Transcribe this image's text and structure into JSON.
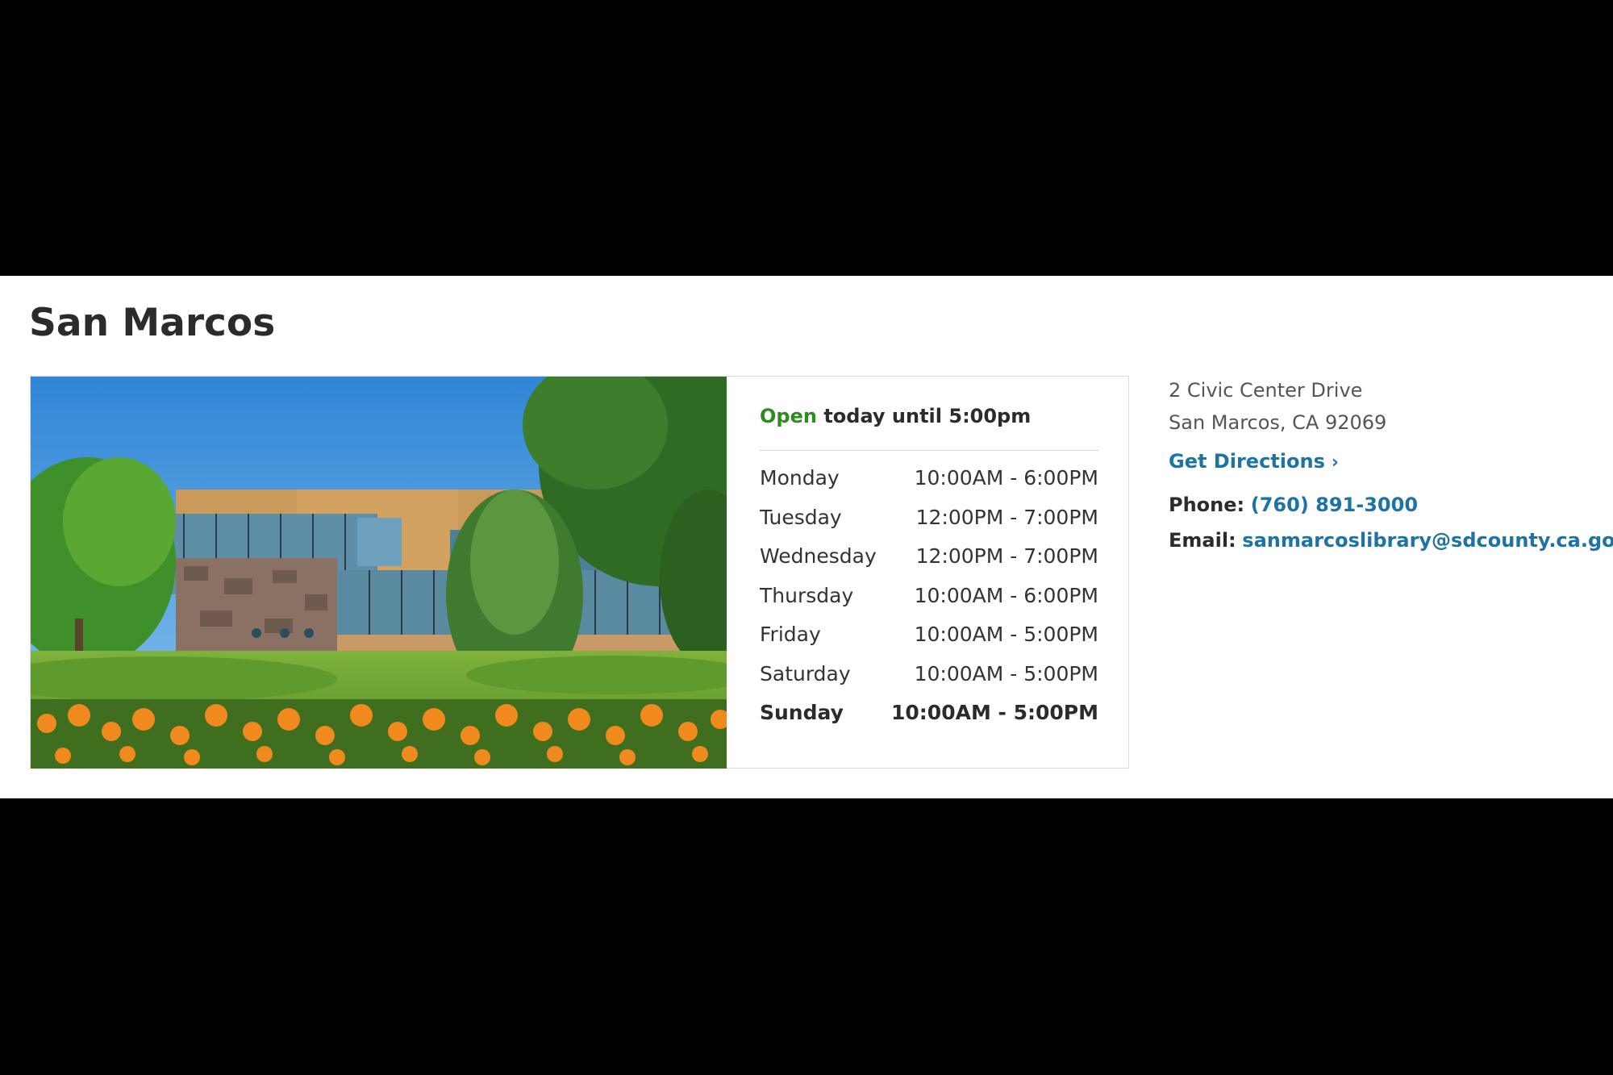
{
  "branch": {
    "name": "San Marcos"
  },
  "photo": {
    "description_icon": "library-building-photo"
  },
  "status": {
    "state": "Open",
    "detail": "today until 5:00pm"
  },
  "hours": [
    {
      "day": "Monday",
      "time": "10:00AM - 6:00PM"
    },
    {
      "day": "Tuesday",
      "time": "12:00PM - 7:00PM"
    },
    {
      "day": "Wednesday",
      "time": "12:00PM - 7:00PM"
    },
    {
      "day": "Thursday",
      "time": "10:00AM - 6:00PM"
    },
    {
      "day": "Friday",
      "time": "10:00AM - 5:00PM"
    },
    {
      "day": "Saturday",
      "time": "10:00AM - 5:00PM"
    },
    {
      "day": "Sunday",
      "time": "10:00AM - 5:00PM"
    }
  ],
  "address": {
    "line1": "2 Civic Center Drive",
    "line2": "San Marcos, CA 92069",
    "directions_label": "Get Directions",
    "directions_icon": "chevron-right-icon"
  },
  "contact": {
    "phone_label": "Phone:",
    "phone": "(760) 891-3000",
    "email_label": "Email:",
    "email": "sanmarcoslibrary@sdcounty.ca.gov"
  },
  "colors": {
    "open_green": "#2e8b1f",
    "link_blue": "#1d73a6",
    "heading": "#2b2b2b"
  }
}
